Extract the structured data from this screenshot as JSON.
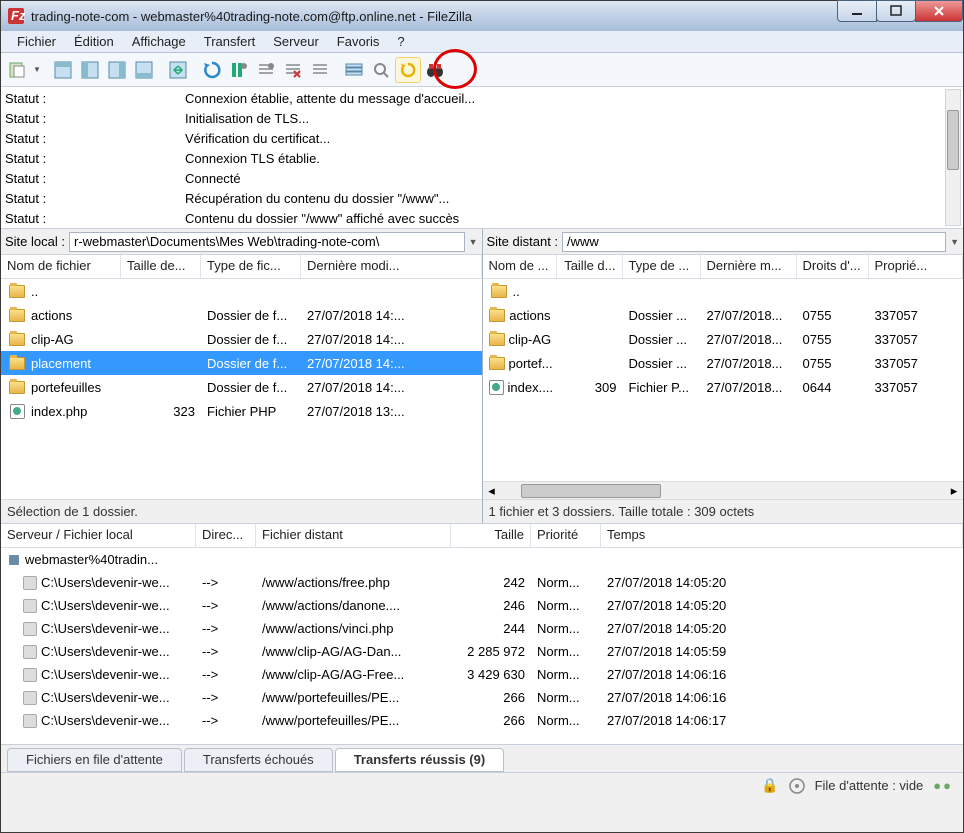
{
  "window": {
    "title": "trading-note-com - webmaster%40trading-note.com@ftp.online.net - FileZilla"
  },
  "menu": [
    "Fichier",
    "Édition",
    "Affichage",
    "Transfert",
    "Serveur",
    "Favoris",
    "?"
  ],
  "log": [
    {
      "label": "Statut :",
      "msg": "Connexion établie, attente du message d'accueil..."
    },
    {
      "label": "Statut :",
      "msg": "Initialisation de TLS..."
    },
    {
      "label": "Statut :",
      "msg": "Vérification du certificat..."
    },
    {
      "label": "Statut :",
      "msg": "Connexion TLS établie."
    },
    {
      "label": "Statut :",
      "msg": "Connecté"
    },
    {
      "label": "Statut :",
      "msg": "Récupération du contenu du dossier \"/www\"..."
    },
    {
      "label": "Statut :",
      "msg": "Contenu du dossier \"/www\" affiché avec succès"
    }
  ],
  "local": {
    "site_label": "Site local :",
    "path": "r-webmaster\\Documents\\Mes Web\\trading-note-com\\",
    "cols": [
      "Nom de fichier",
      "Taille de...",
      "Type de fic...",
      "Dernière modi..."
    ],
    "rows": [
      {
        "icon": "folder",
        "name": "..",
        "size": "",
        "type": "",
        "date": ""
      },
      {
        "icon": "folder",
        "name": "actions",
        "size": "",
        "type": "Dossier de f...",
        "date": "27/07/2018 14:..."
      },
      {
        "icon": "folder",
        "name": "clip-AG",
        "size": "",
        "type": "Dossier de f...",
        "date": "27/07/2018 14:..."
      },
      {
        "icon": "folder",
        "name": "placement",
        "size": "",
        "type": "Dossier de f...",
        "date": "27/07/2018 14:...",
        "selected": true
      },
      {
        "icon": "folder",
        "name": "portefeuilles",
        "size": "",
        "type": "Dossier de f...",
        "date": "27/07/2018 14:..."
      },
      {
        "icon": "php",
        "name": "index.php",
        "size": "323",
        "type": "Fichier PHP",
        "date": "27/07/2018 13:..."
      }
    ],
    "status": "Sélection de 1 dossier."
  },
  "remote": {
    "site_label": "Site distant :",
    "path": "/www",
    "cols": [
      "Nom de ...",
      "Taille d...",
      "Type de ...",
      "Dernière m...",
      "Droits d'...",
      "Proprié..."
    ],
    "rows": [
      {
        "icon": "folder",
        "name": "..",
        "size": "",
        "type": "",
        "date": "",
        "perm": "",
        "own": ""
      },
      {
        "icon": "folder",
        "name": "actions",
        "size": "",
        "type": "Dossier ...",
        "date": "27/07/2018...",
        "perm": "0755",
        "own": "337057"
      },
      {
        "icon": "folder",
        "name": "clip-AG",
        "size": "",
        "type": "Dossier ...",
        "date": "27/07/2018...",
        "perm": "0755",
        "own": "337057"
      },
      {
        "icon": "folder",
        "name": "portef...",
        "size": "",
        "type": "Dossier ...",
        "date": "27/07/2018...",
        "perm": "0755",
        "own": "337057"
      },
      {
        "icon": "php",
        "name": "index....",
        "size": "309",
        "type": "Fichier P...",
        "date": "27/07/2018...",
        "perm": "0644",
        "own": "337057"
      }
    ],
    "status": "1 fichier et 3 dossiers. Taille totale : 309 octets"
  },
  "queue": {
    "cols": [
      "Serveur / Fichier local",
      "Direc...",
      "Fichier distant",
      "Taille",
      "Priorité",
      "Temps"
    ],
    "server": "webmaster%40tradin...",
    "rows": [
      {
        "local": "C:\\Users\\devenir-we...",
        "dir": "-->",
        "remote": "/www/actions/free.php",
        "size": "242",
        "prio": "Norm...",
        "time": "27/07/2018 14:05:20"
      },
      {
        "local": "C:\\Users\\devenir-we...",
        "dir": "-->",
        "remote": "/www/actions/danone....",
        "size": "246",
        "prio": "Norm...",
        "time": "27/07/2018 14:05:20"
      },
      {
        "local": "C:\\Users\\devenir-we...",
        "dir": "-->",
        "remote": "/www/actions/vinci.php",
        "size": "244",
        "prio": "Norm...",
        "time": "27/07/2018 14:05:20"
      },
      {
        "local": "C:\\Users\\devenir-we...",
        "dir": "-->",
        "remote": "/www/clip-AG/AG-Dan...",
        "size": "2 285 972",
        "prio": "Norm...",
        "time": "27/07/2018 14:05:59"
      },
      {
        "local": "C:\\Users\\devenir-we...",
        "dir": "-->",
        "remote": "/www/clip-AG/AG-Free...",
        "size": "3 429 630",
        "prio": "Norm...",
        "time": "27/07/2018 14:06:16"
      },
      {
        "local": "C:\\Users\\devenir-we...",
        "dir": "-->",
        "remote": "/www/portefeuilles/PE...",
        "size": "266",
        "prio": "Norm...",
        "time": "27/07/2018 14:06:16"
      },
      {
        "local": "C:\\Users\\devenir-we...",
        "dir": "-->",
        "remote": "/www/portefeuilles/PE...",
        "size": "266",
        "prio": "Norm...",
        "time": "27/07/2018 14:06:17"
      }
    ]
  },
  "tabs": {
    "queued": "Fichiers en file d'attente",
    "failed": "Transferts échoués",
    "success": "Transferts réussis (9)"
  },
  "footer": {
    "queue": "File d'attente : vide"
  }
}
